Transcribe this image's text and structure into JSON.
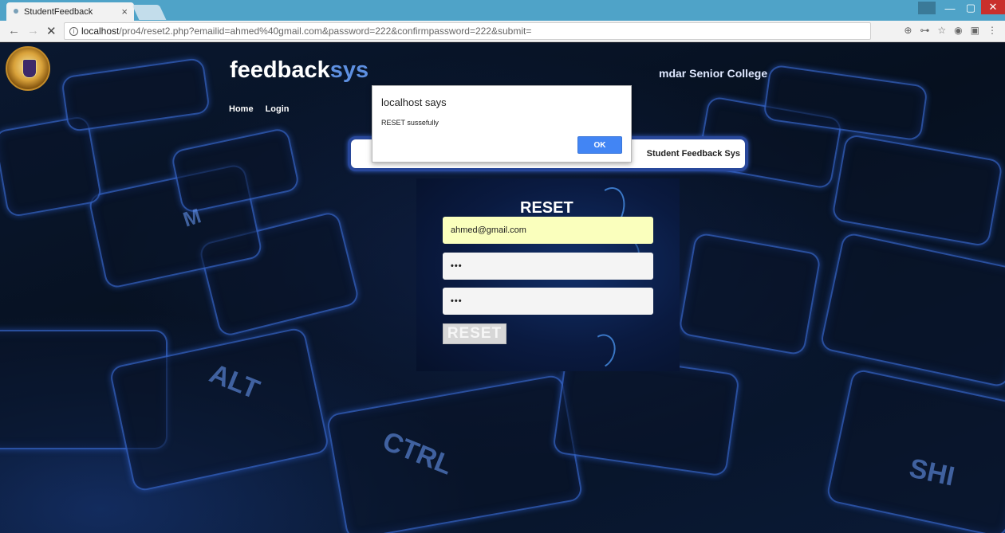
{
  "browser": {
    "tab_title": "StudentFeedback",
    "tab_close": "×",
    "url_host": "localhost",
    "url_path": "/pro4/reset2.php?emailid=ahmed%40gmail.com&password=222&confirmpassword=222&submit=",
    "nav_back": "←",
    "nav_forward": "→",
    "nav_stop": "✕",
    "info_icon": "i",
    "extensions": [
      "⊕",
      "⊶",
      "☆",
      "◉",
      "▣",
      "⋮"
    ],
    "win_minimize": "—",
    "win_maximize": "▢",
    "win_close": "✕"
  },
  "site": {
    "title_main": "feedback",
    "title_accent": "sys",
    "college": "mdar Senior College",
    "nav": [
      "Home",
      "Login"
    ],
    "banner_text": "Student Feedback Sys"
  },
  "keyboard_labels": [
    "ALT",
    "CTRL",
    "M",
    "SHI"
  ],
  "form": {
    "title": "RESET",
    "email_value": "ahmed@gmail.com",
    "password_value": "•••",
    "confirm_password_value": "•••",
    "submit_label": "RESET"
  },
  "dialog": {
    "title": "localhost says",
    "message": "RESET sussefully",
    "ok_label": "OK"
  },
  "colors": {
    "accent": "#5d8fe0",
    "tabbar": "#4fa3c8",
    "ok_button": "#4285f4",
    "autofill": "#faffbd"
  }
}
